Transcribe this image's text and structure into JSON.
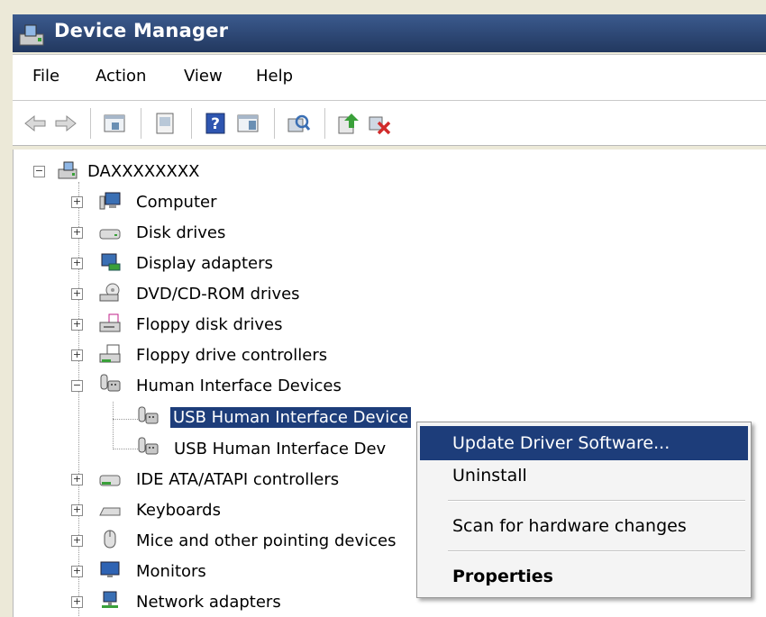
{
  "window": {
    "title": "Device Manager"
  },
  "menu": [
    "File",
    "Action",
    "View",
    "Help"
  ],
  "toolbar": {
    "buttons": [
      "back-arrow-icon",
      "forward-arrow-icon",
      "show-hide-console-tree-icon",
      "properties-sheet-icon",
      "help-icon",
      "action-pane-icon",
      "scan-hardware-icon",
      "update-driver-icon",
      "uninstall-icon"
    ]
  },
  "tree": {
    "root": "DAXXXXXXXX",
    "categories": [
      "Computer",
      "Disk drives",
      "Display adapters",
      "DVD/CD-ROM drives",
      "Floppy disk drives",
      "Floppy drive controllers",
      "Human Interface Devices",
      "IDE ATA/ATAPI controllers",
      "Keyboards",
      "Mice and other pointing devices",
      "Monitors",
      "Network adapters"
    ],
    "hid_children": [
      "USB Human Interface Device",
      "USB Human Interface Dev"
    ],
    "expander_collapsed": "+",
    "expander_expanded": "−"
  },
  "context_menu": {
    "items": [
      "Update Driver Software...",
      "Uninstall",
      "Scan for hardware changes",
      "Properties"
    ]
  },
  "colors": {
    "selection": "#1d3d7a",
    "titlebar": "#2b4270"
  }
}
